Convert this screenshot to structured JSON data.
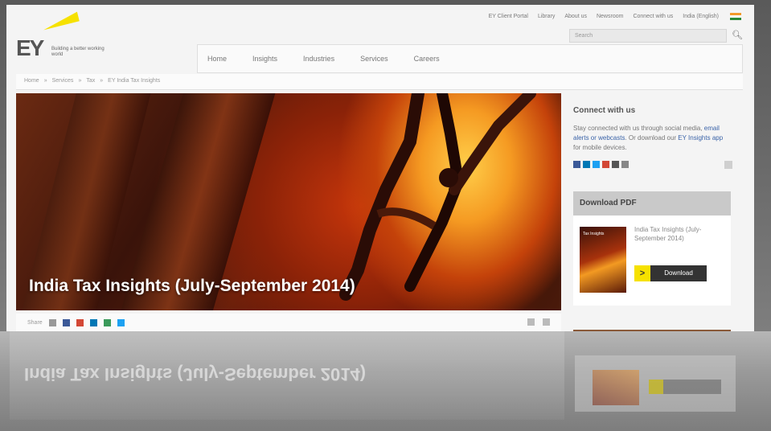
{
  "top_links": [
    "EY Client Portal",
    "Library",
    "About us",
    "Newsroom",
    "Connect with us",
    "India (English)"
  ],
  "search": {
    "placeholder": "Search"
  },
  "logo": {
    "brand": "EY",
    "tagline": "Building a better working world"
  },
  "nav": {
    "items": [
      "Home",
      "Insights",
      "Industries",
      "Services",
      "Careers"
    ]
  },
  "breadcrumb": [
    "Home",
    "Services",
    "Tax",
    "EY India Tax Insights"
  ],
  "breadcrumb_sep": "»",
  "hero": {
    "title": "India Tax Insights (July-September 2014)"
  },
  "connect": {
    "title": "Connect with us",
    "text_a": "Stay connected with us through social media, ",
    "text_link1": "email alerts or webcasts",
    "text_b": ". Or download our ",
    "text_link2": "EY Insights app",
    "text_c": " for mobile devices."
  },
  "download": {
    "heading": "Download PDF",
    "doc_title": "India Tax Insights (July-September 2014)",
    "button_label": "Download",
    "button_arrow": ">",
    "thumb_title": "Tax Insights"
  },
  "share": {
    "label": "Share"
  },
  "colors": {
    "accent": "#f6e100",
    "facebook": "#3b5998",
    "twitter": "#1da1f2",
    "gplus": "#d34836",
    "linkedin": "#0077b5"
  }
}
